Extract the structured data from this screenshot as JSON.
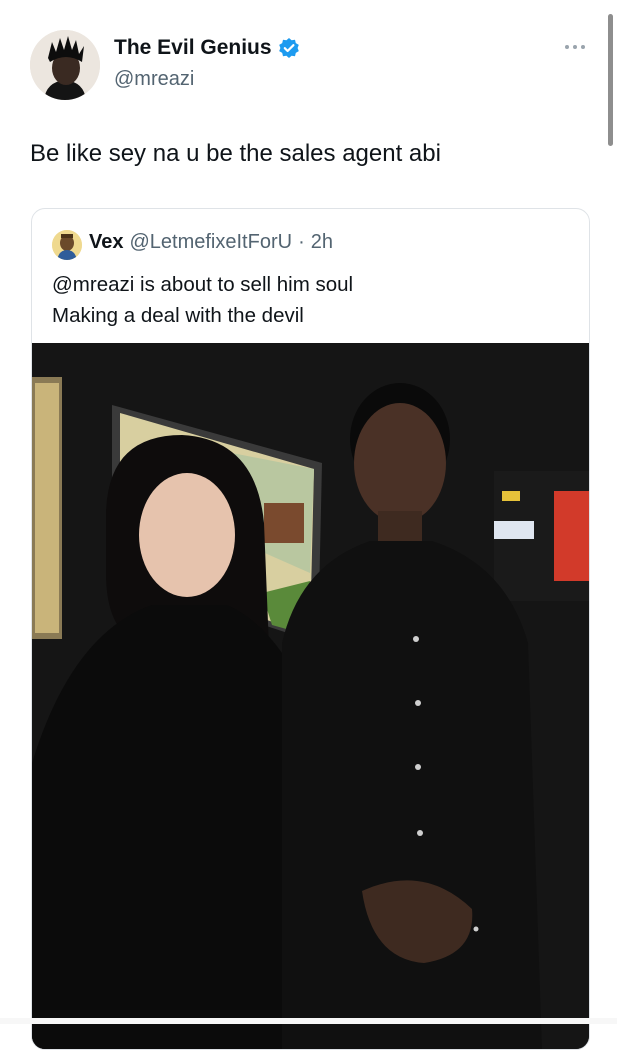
{
  "tweet": {
    "author_name": "The Evil Genius",
    "author_handle": "@mreazi",
    "text": "Be like sey na u be the sales agent abi",
    "verified": true,
    "more_icon": "more-horizontal-icon"
  },
  "quote": {
    "author_name": "Vex",
    "author_handle": "@LetmefixeItForU",
    "separator": "·",
    "time": "2h",
    "text_line1": "@mreazi is about to sell him soul",
    "text_line2": "Making a deal with the devil"
  },
  "colors": {
    "verified_blue": "#1d9bf0",
    "secondary_text": "#536471",
    "border": "#dfe3e7"
  }
}
